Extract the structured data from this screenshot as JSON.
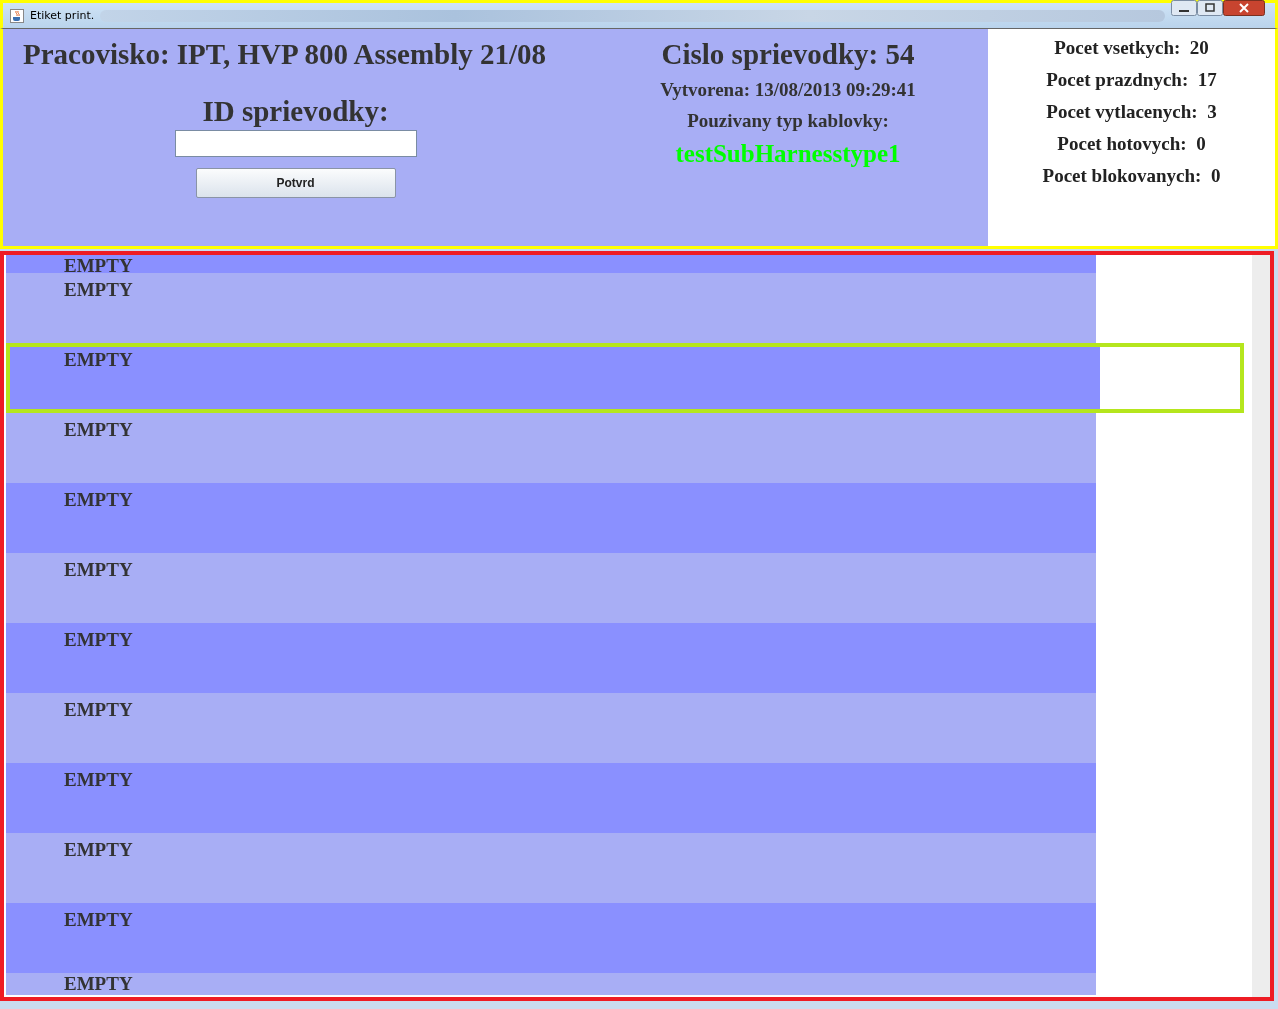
{
  "window": {
    "title": "Etiket print."
  },
  "header": {
    "workplace": "Pracovisko: IPT, HVP 800 Assembly 21/08",
    "id_label": "ID sprievodky:",
    "confirm_button": "Potvrd",
    "number": "Cislo sprievodky: 54",
    "created": "Vytvorena: 13/08/2013 09:29:41",
    "type_label": "Pouzivany typ kablovky:",
    "type_value": "testSubHarnesstype1"
  },
  "counts": [
    {
      "label": "Pocet vsetkych:",
      "value": "20"
    },
    {
      "label": "Pocet prazdnych:",
      "value": "17"
    },
    {
      "label": "Pocet vytlacenych:",
      "value": "3"
    },
    {
      "label": "Pocet hotovych:",
      "value": "0"
    },
    {
      "label": "Pocet blokovanych:",
      "value": "0"
    }
  ],
  "rows": [
    {
      "text": "EMPTY",
      "selected": false
    },
    {
      "text": "EMPTY",
      "selected": false
    },
    {
      "text": "EMPTY",
      "selected": true
    },
    {
      "text": "EMPTY",
      "selected": false
    },
    {
      "text": "EMPTY",
      "selected": false
    },
    {
      "text": "EMPTY",
      "selected": false
    },
    {
      "text": "EMPTY",
      "selected": false
    },
    {
      "text": "EMPTY",
      "selected": false
    },
    {
      "text": "EMPTY",
      "selected": false
    },
    {
      "text": "EMPTY",
      "selected": false
    },
    {
      "text": "EMPTY",
      "selected": false
    },
    {
      "text": "EMPTY",
      "selected": false
    }
  ]
}
